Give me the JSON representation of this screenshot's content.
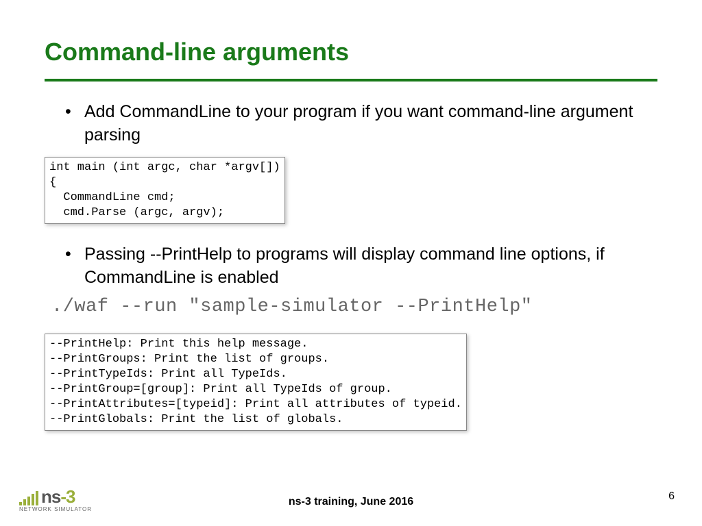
{
  "title": "Command-line arguments",
  "bullets": {
    "b1": "Add CommandLine to your program if you want command-line argument parsing",
    "b2": "Passing --PrintHelp to programs will display command line options, if CommandLine is enabled"
  },
  "code1": "int main (int argc, char *argv[])\n{\n  CommandLine cmd;\n  cmd.Parse (argc, argv);",
  "cmdline": "./waf --run \"sample-simulator --PrintHelp\"",
  "code2": "--PrintHelp: Print this help message.\n--PrintGroups: Print the list of groups.\n--PrintTypeIds: Print all TypeIds.\n--PrintGroup=[group]: Print all TypeIds of group.\n--PrintAttributes=[typeid]: Print all attributes of typeid.\n--PrintGlobals: Print the list of globals.",
  "footer": "ns-3 training, June 2016",
  "page": "6",
  "logo": {
    "name": "ns-3",
    "sub": "NETWORK SIMULATOR"
  }
}
